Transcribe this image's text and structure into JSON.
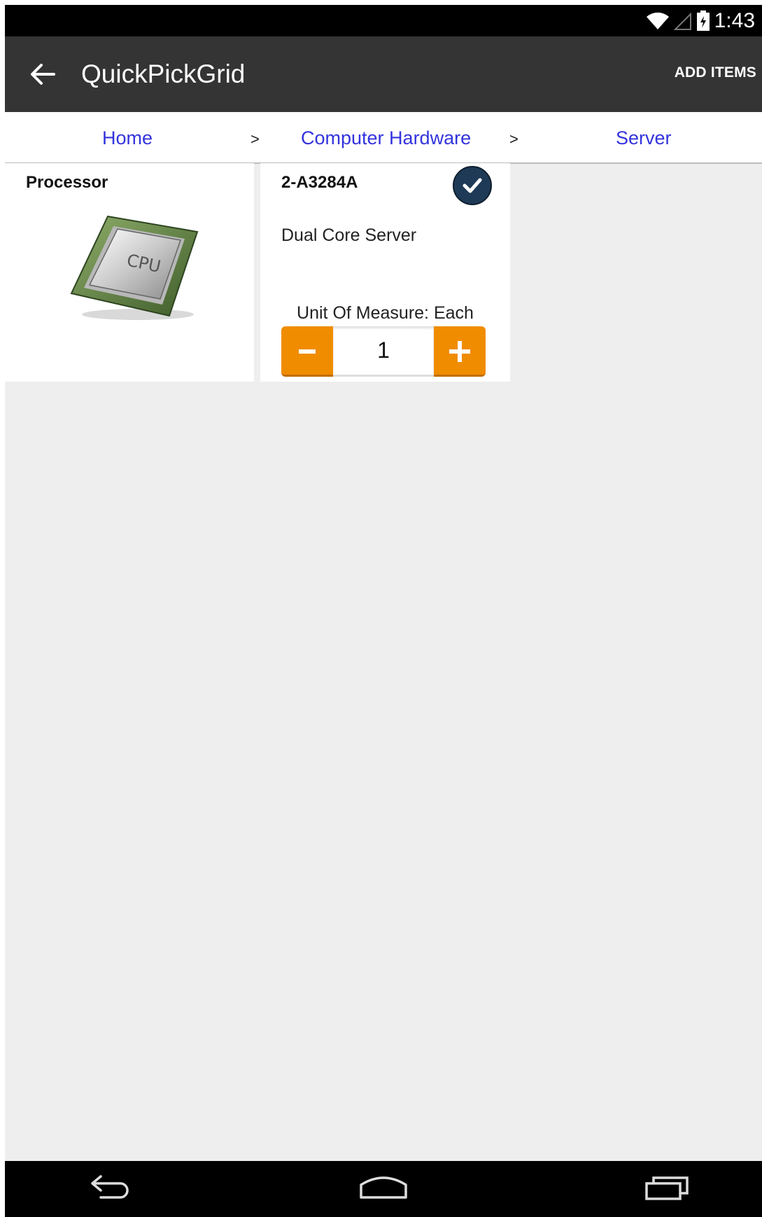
{
  "status_bar": {
    "time": "1:43",
    "icons": [
      "wifi-icon",
      "cell-signal-icon",
      "battery-icon"
    ]
  },
  "app_bar": {
    "title": "QuickPickGrid",
    "action_label": "ADD ITEMS",
    "back_icon": "arrow-left-icon"
  },
  "breadcrumb": {
    "items": [
      "Home",
      "Computer Hardware",
      "Server"
    ],
    "separator": ">"
  },
  "category_card": {
    "title": "Processor",
    "image_icon": "cpu-chip-icon",
    "image_text": "CPU"
  },
  "item_card": {
    "sku": "2-A3284A",
    "description": "Dual Core Server",
    "unit_of_measure": "Unit Of Measure: Each",
    "quantity": "1",
    "selected": true
  },
  "nav_bar": {
    "icons": [
      "back-nav-icon",
      "home-nav-icon",
      "recents-nav-icon"
    ]
  },
  "colors": {
    "accent": "#f08c00",
    "app_bar": "#343434",
    "link": "#3333dd",
    "badge": "#1f3a56"
  }
}
